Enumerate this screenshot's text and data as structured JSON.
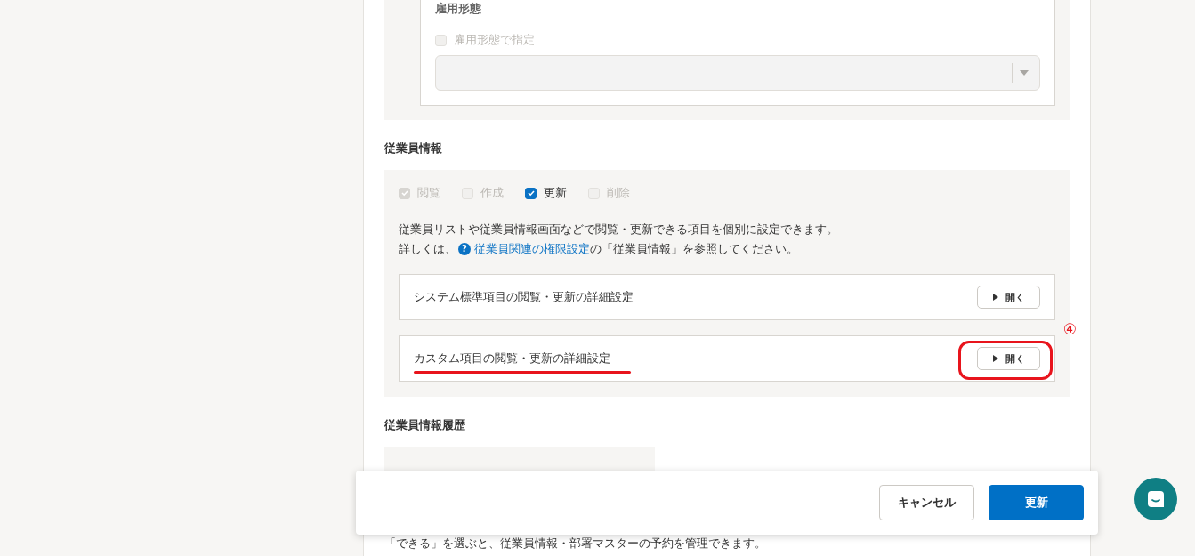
{
  "employment_type": {
    "heading": "雇用形態",
    "filter_checkbox": {
      "label": "雇用形態で指定",
      "checked": false,
      "disabled": true
    },
    "select": {
      "disabled": true
    }
  },
  "employee_info": {
    "heading": "従業員情報",
    "permissions": [
      {
        "label": "閲覧",
        "checked": true,
        "disabled": true
      },
      {
        "label": "作成",
        "checked": false,
        "disabled": true
      },
      {
        "label": "更新",
        "checked": true,
        "disabled": false
      },
      {
        "label": "削除",
        "checked": false,
        "disabled": true
      }
    ],
    "description": "従業員リストや従業員情報画面などで閲覧・更新できる項目を個別に設定できます。",
    "help_prefix": "詳しくは、",
    "help_icon": "?",
    "help_link": "従業員関連の権限設定",
    "help_suffix": " の「従業員情報」を参照してください。",
    "detail_panels": [
      {
        "title": "システム標準項目の閲覧・更新の詳細設定",
        "button": "開く",
        "annotated": false
      },
      {
        "title": "カスタム項目の閲覧・更新の詳細設定",
        "button": "開く",
        "annotated": true
      }
    ],
    "annotation_number": "④"
  },
  "employee_history": {
    "heading": "従業員情報履歴"
  },
  "reservation_note": "「できる」を選ぶと、従業員情報・部署マスターの予約を管理できます。",
  "footer": {
    "cancel": "キャンセル",
    "submit": "更新"
  }
}
